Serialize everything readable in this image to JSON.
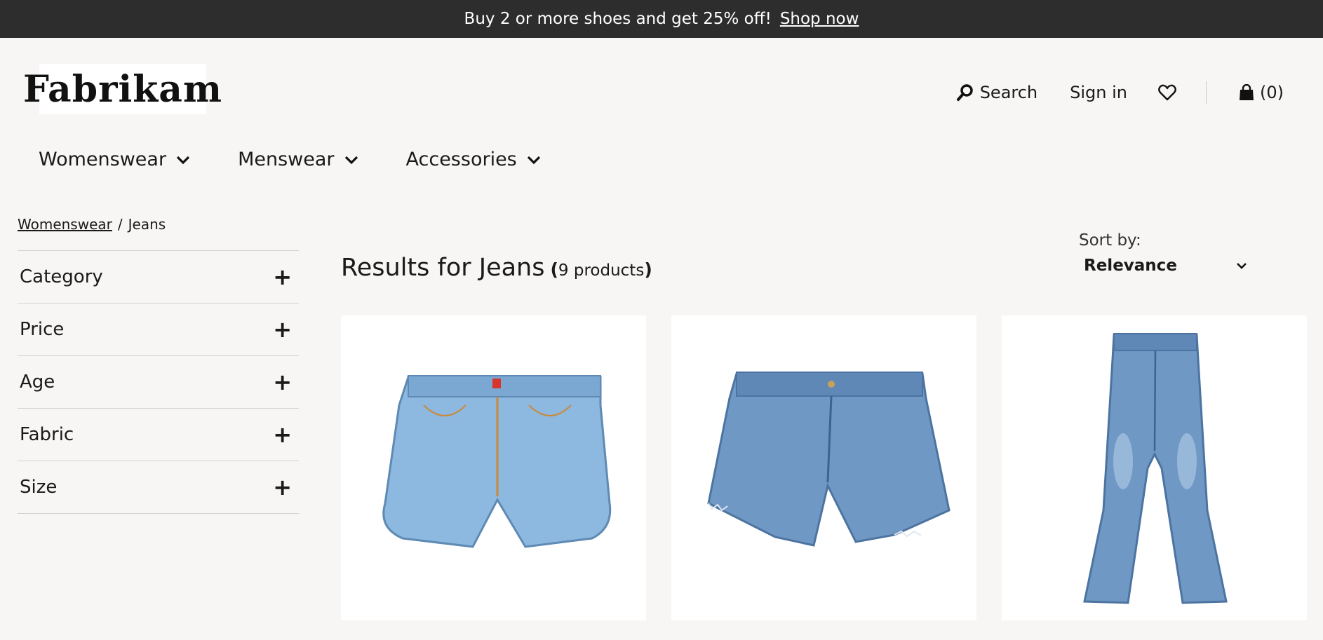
{
  "banner": {
    "text": "Buy 2 or more shoes and get 25% off!",
    "link": "Shop now"
  },
  "logo": {
    "text": "Fabrikam"
  },
  "header": {
    "search_label": "Search",
    "signin_label": "Sign in",
    "cart_label": "(0)",
    "icons": [
      "search-icon",
      "heart-icon",
      "shopping-bag-icon"
    ]
  },
  "nav": {
    "items": [
      {
        "label": "Womenswear"
      },
      {
        "label": "Menswear"
      },
      {
        "label": "Accessories"
      }
    ]
  },
  "breadcrumb": {
    "parent": "Womenswear",
    "separator": "/",
    "current": "Jeans"
  },
  "filters": [
    {
      "label": "Category"
    },
    {
      "label": "Price"
    },
    {
      "label": "Age"
    },
    {
      "label": "Fabric"
    },
    {
      "label": "Size"
    }
  ],
  "results": {
    "prefix": "Results for Jeans",
    "open": "(",
    "count": "9 products",
    "close": ")"
  },
  "sort": {
    "label": "Sort by:",
    "value": "Relevance"
  },
  "products": [
    {
      "image": "light-wash-denim-shorts"
    },
    {
      "image": "frayed-denim-shorts"
    },
    {
      "image": "flared-jeans"
    }
  ],
  "colors": {
    "banner_bg": "#2d2d2d",
    "page_bg": "#f7f6f4",
    "denim_light": "#8db8df",
    "denim_mid": "#6f98c4"
  }
}
